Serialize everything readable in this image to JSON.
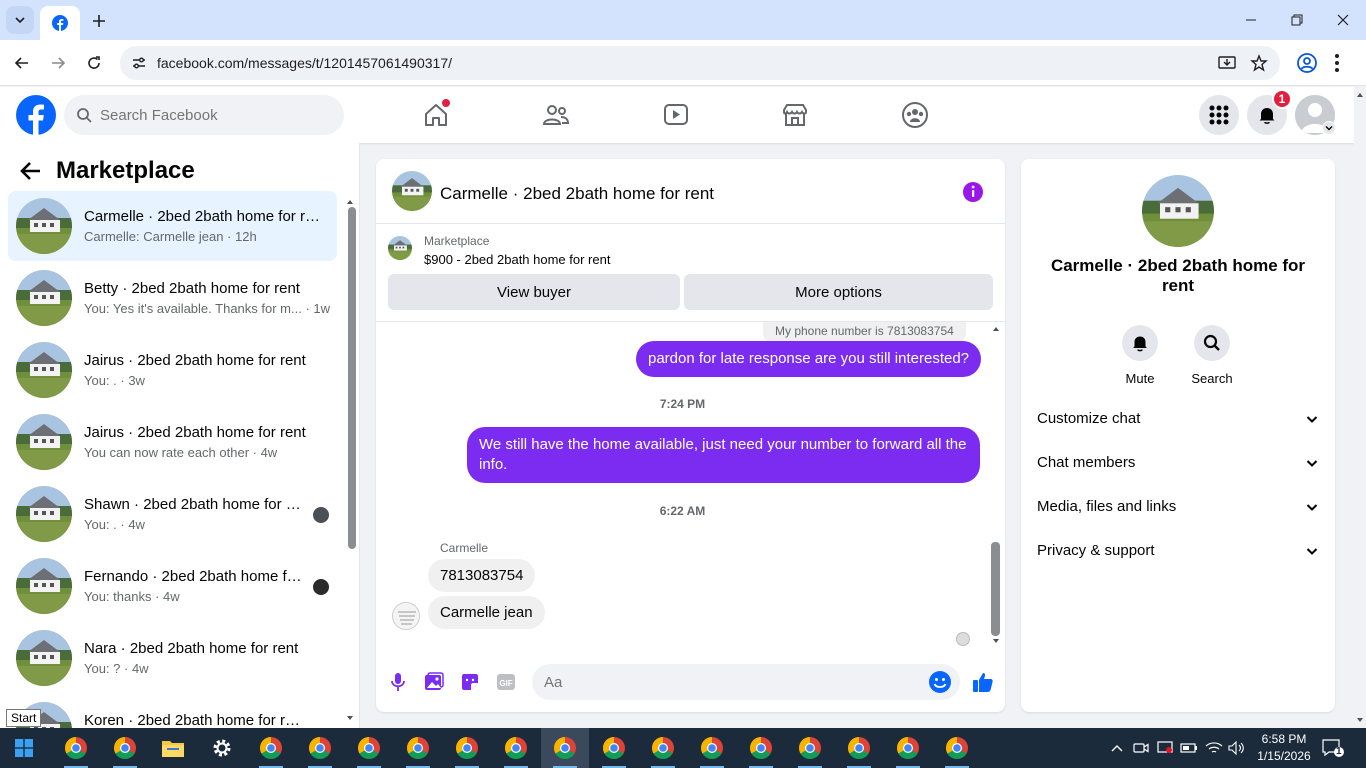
{
  "browser": {
    "url": "facebook.com/messages/t/1201457061490317/"
  },
  "fb_header": {
    "search_placeholder": "Search Facebook",
    "notification_count": "1"
  },
  "sidebar": {
    "title": "Marketplace",
    "conversations": [
      {
        "name": "Carmelle · 2bed 2bath home for rent",
        "preview": "Carmelle: Carmelle jean · 12h",
        "active": true
      },
      {
        "name": "Betty · 2bed 2bath home for rent",
        "preview": "You: Yes it's available. Thanks for m... · 1w"
      },
      {
        "name": "Jairus · 2bed 2bath home for rent",
        "preview": "You: . · 3w"
      },
      {
        "name": "Jairus · 2bed 2bath home for rent",
        "preview": "You can now rate each other · 4w"
      },
      {
        "name": "Shawn · 2bed 2bath home for rent",
        "preview": "You: . · 4w"
      },
      {
        "name": "Fernando · 2bed 2bath home for rent",
        "preview": "You: thanks · 4w"
      },
      {
        "name": "Nara · 2bed 2bath home for rent",
        "preview": "You: ? · 4w"
      },
      {
        "name": "Koren · 2bed 2bath home for rent",
        "preview": ""
      }
    ],
    "tooltip": "Start"
  },
  "chat": {
    "title": "Carmelle · 2bed 2bath home for rent",
    "marketplace_label": "Marketplace",
    "listing": "$900 - 2bed 2bath home for rent",
    "view_buyer": "View buyer",
    "more_options": "More options",
    "quoted": "My phone number is 7813083754",
    "messages": {
      "out1": "pardon for late response are you still interested?",
      "ts1": "7:24 PM",
      "out2": "We still have the home available, just need your number to forward all the info.",
      "ts2": "6:22 AM",
      "sender": "Carmelle",
      "in1": "7813083754",
      "in2": "Carmelle jean"
    },
    "composer_placeholder": "Aa"
  },
  "info_panel": {
    "name": "Carmelle · 2bed 2bath home for rent",
    "mute": "Mute",
    "search": "Search",
    "sections": [
      "Customize chat",
      "Chat members",
      "Media, files and links",
      "Privacy & support"
    ]
  },
  "taskbar": {
    "time": "6:58 PM",
    "date": "1/15/2026",
    "notif_count": "1"
  },
  "colors": {
    "accent_purple": "#7b2cf0",
    "fb_blue": "#0866ff",
    "active_row": "#e7f3ff"
  }
}
